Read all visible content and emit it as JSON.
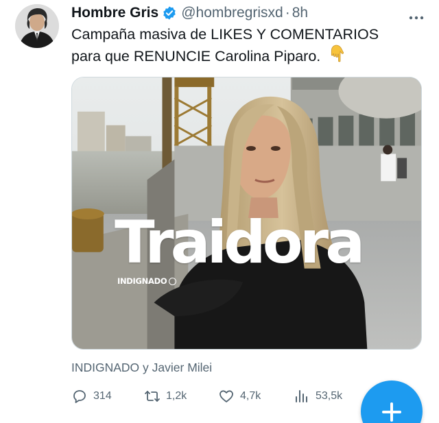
{
  "tweet": {
    "author": {
      "display_name": "Hombre Gris",
      "handle": "@hombregrisxd",
      "separator": "·",
      "time": "8h",
      "verified": true
    },
    "text_lines": [
      "Campaña masiva de LIKES Y COMENTARIOS",
      "para que RENUNCIE Carolina Piparo."
    ],
    "emoji": "👇",
    "media": {
      "overlay_title": "Traidora",
      "overlay_brand": "INDIGNADO"
    },
    "social_context": "INDIGNADO y Javier Milei",
    "actions": {
      "replies": "314",
      "retweets": "1,2k",
      "likes": "4,7k",
      "views": "53,5k"
    }
  },
  "icons": {
    "more": "more-horizontal-icon",
    "verified": "verified-badge-icon",
    "reply": "reply-icon",
    "retweet": "retweet-icon",
    "like": "heart-icon",
    "views": "views-icon",
    "compose": "plus-icon"
  },
  "colors": {
    "accent": "#1d9bf0",
    "text_secondary": "#536471",
    "text_primary": "#0f1419"
  }
}
